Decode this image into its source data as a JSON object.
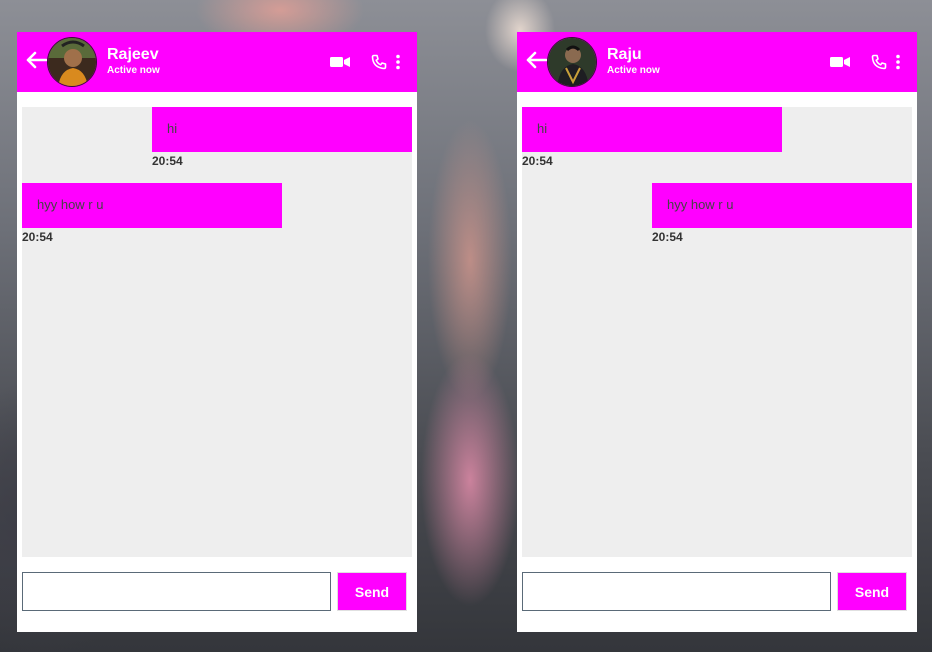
{
  "colors": {
    "accent": "#ff00ff",
    "panel": "#eeeeee",
    "text": "#444444"
  },
  "left_chat": {
    "contact_name": "Rajeev",
    "status": "Active now",
    "icons": [
      "back-arrow-icon",
      "video-camera-icon",
      "phone-icon",
      "more-vertical-icon"
    ],
    "messages": [
      {
        "direction": "sent",
        "text": "hi",
        "time": "20:54"
      },
      {
        "direction": "received",
        "text": "hyy how r u",
        "time": "20:54"
      }
    ],
    "input_value": "",
    "send_label": "Send"
  },
  "right_chat": {
    "contact_name": "Raju",
    "status": "Active now",
    "icons": [
      "back-arrow-icon",
      "video-camera-icon",
      "phone-icon",
      "more-vertical-icon"
    ],
    "messages": [
      {
        "direction": "received",
        "text": "hi",
        "time": "20:54"
      },
      {
        "direction": "sent",
        "text": "hyy how r u",
        "time": "20:54"
      }
    ],
    "input_value": "",
    "send_label": "Send"
  }
}
